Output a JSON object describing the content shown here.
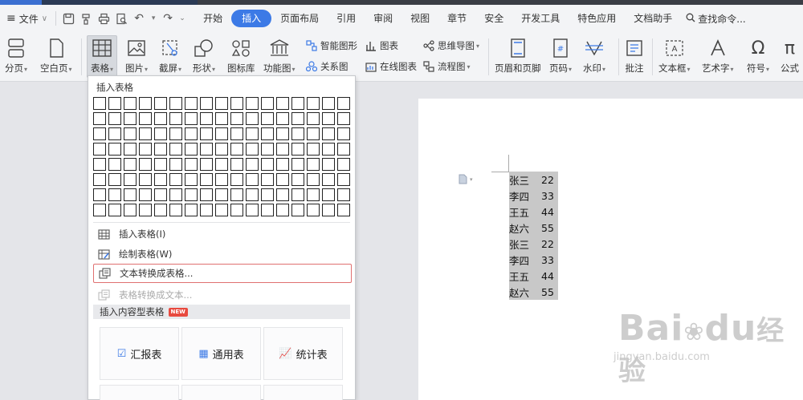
{
  "menubar": {
    "file_label": "文件",
    "tabs": [
      "开始",
      "插入",
      "页面布局",
      "引用",
      "审阅",
      "视图",
      "章节",
      "安全",
      "开发工具",
      "特色应用",
      "文档助手"
    ],
    "active_tab": "插入",
    "search_label": "查找命令..."
  },
  "ribbon": {
    "page_break": "分页",
    "blank_page": "空白页",
    "table": "表格",
    "picture": "图片",
    "screenshot": "截屏",
    "shape": "形状",
    "icon_lib": "图标库",
    "func_chart": "功能图",
    "smart_shape": "智能图形",
    "chart": "图表",
    "mind_map": "思维导图",
    "relation": "关系图",
    "online_chart": "在线图表",
    "flowchart": "流程图",
    "header_footer": "页眉和页脚",
    "page_number": "页码",
    "watermark": "水印",
    "comment": "批注",
    "textbox": "文本框",
    "art_text": "艺术字",
    "symbol": "符号",
    "formula": "公式"
  },
  "dropdown": {
    "title": "插入表格",
    "insert_table": "插入表格(I)",
    "draw_table": "绘制表格(W)",
    "text_to_table": "文本转换成表格...",
    "table_to_text": "表格转换成文本...",
    "content_tables": "插入内容型表格",
    "new_badge": "NEW",
    "templates": [
      "汇报表",
      "通用表",
      "统计表"
    ]
  },
  "document": {
    "rows": [
      {
        "name": "张三",
        "age": "22"
      },
      {
        "name": "李四",
        "age": "33"
      },
      {
        "name": "王五",
        "age": "44"
      },
      {
        "name": "赵六",
        "age": "55"
      },
      {
        "name": "张三",
        "age": "22"
      },
      {
        "name": "李四",
        "age": "33"
      },
      {
        "name": "王五",
        "age": "44"
      },
      {
        "name": "赵六",
        "age": "55"
      }
    ]
  },
  "watermark": {
    "brand": "Bai",
    "brand2": "du",
    "brand3": "经验",
    "url": "jingyan.baidu.com"
  },
  "colors": {
    "accent": "#3c7ae6",
    "highlight_border": "#e07070",
    "selection": "#c8c8c8"
  }
}
